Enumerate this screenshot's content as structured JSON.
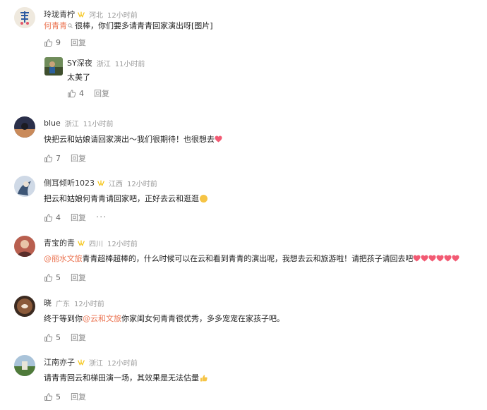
{
  "comments": [
    {
      "name": "玲珑青柠",
      "location": "河北",
      "time": "12小时前",
      "link": "何青青",
      "text_after": " 很棒，你们要多请青青回家演出呀[图片]",
      "likes": "9",
      "reply_label": "回复",
      "replies": [
        {
          "name": "SY深夜",
          "location": "浙江",
          "time": "11小时前",
          "text": "太美了",
          "likes": "4",
          "reply_label": "回复"
        }
      ]
    },
    {
      "name": "blue",
      "location": "浙江",
      "time": "11小时前",
      "text": "快把云和姑娘请回家演出～我们很期待！也很想去",
      "likes": "7",
      "reply_label": "回复"
    },
    {
      "name": "侧耳倾听1023",
      "location": "江西",
      "time": "12小时前",
      "text": "把云和姑娘何青青请回家吧，正好去云和逛逛",
      "likes": "4",
      "reply_label": "回复",
      "more_label": "···"
    },
    {
      "name": "青宝的青",
      "location": "四川",
      "time": "12小时前",
      "link": "@丽水文旅",
      "text_after": " 青青超棒超棒的，什么时候可以在云和看到青青的演出呢，我想去云和旅游啦！请把孩子请回去吧",
      "likes": "5",
      "reply_label": "回复"
    },
    {
      "name": "晓",
      "location": "广东",
      "time": "12小时前",
      "text_before": "终于等到你",
      "link": "@云和文旅",
      "text_after": " 你家闺女何青青很优秀，多多宠宠在家孩子吧。",
      "likes": "5",
      "reply_label": "回复"
    },
    {
      "name": "江南亦子",
      "location": "浙江",
      "time": "12小时前",
      "text": "请青青回云和梯田演一场，其效果是无法估量",
      "likes": "5",
      "reply_label": "回复"
    }
  ],
  "colors": {
    "link": "#eb7350",
    "badge": "#f5c518",
    "heart": "#f25a73",
    "muted": "#999999"
  }
}
